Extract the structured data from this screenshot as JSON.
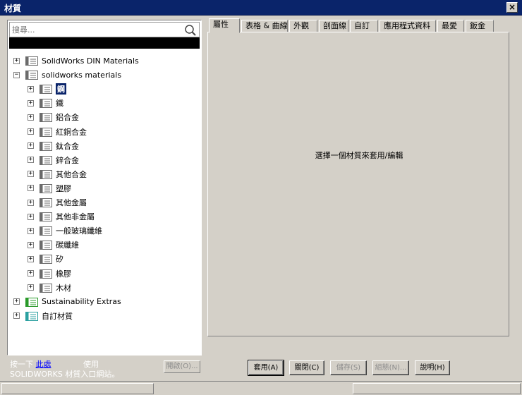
{
  "window": {
    "title": "材質"
  },
  "search": {
    "placeholder": "搜尋..."
  },
  "tree": [
    {
      "label": "SolidWorks DIN Materials",
      "level": 0,
      "expander": "+",
      "icon_color": "#6b6b6b"
    },
    {
      "label": "solidworks materials",
      "level": 0,
      "expander": "−",
      "icon_color": "#6b6b6b"
    },
    {
      "label": "鋼",
      "level": 1,
      "expander": "+",
      "icon_color": "#6b6b6b",
      "selected": true
    },
    {
      "label": "鐵",
      "level": 1,
      "expander": "+",
      "icon_color": "#6b6b6b"
    },
    {
      "label": "鋁合金",
      "level": 1,
      "expander": "+",
      "icon_color": "#6b6b6b"
    },
    {
      "label": "紅銅合金",
      "level": 1,
      "expander": "+",
      "icon_color": "#6b6b6b"
    },
    {
      "label": "鈦合金",
      "level": 1,
      "expander": "+",
      "icon_color": "#6b6b6b"
    },
    {
      "label": "鋅合金",
      "level": 1,
      "expander": "+",
      "icon_color": "#6b6b6b"
    },
    {
      "label": "其他合金",
      "level": 1,
      "expander": "+",
      "icon_color": "#6b6b6b"
    },
    {
      "label": "塑膠",
      "level": 1,
      "expander": "+",
      "icon_color": "#6b6b6b"
    },
    {
      "label": "其他金屬",
      "level": 1,
      "expander": "+",
      "icon_color": "#6b6b6b"
    },
    {
      "label": "其他非金屬",
      "level": 1,
      "expander": "+",
      "icon_color": "#6b6b6b"
    },
    {
      "label": "一般玻璃纖維",
      "level": 1,
      "expander": "+",
      "icon_color": "#6b6b6b"
    },
    {
      "label": "碳纖維",
      "level": 1,
      "expander": "+",
      "icon_color": "#6b6b6b"
    },
    {
      "label": "矽",
      "level": 1,
      "expander": "+",
      "icon_color": "#6b6b6b"
    },
    {
      "label": "橡膠",
      "level": 1,
      "expander": "+",
      "icon_color": "#6b6b6b"
    },
    {
      "label": "木材",
      "level": 1,
      "expander": "+",
      "icon_color": "#6b6b6b"
    },
    {
      "label": "Sustainability Extras",
      "level": 0,
      "expander": "+",
      "icon_color": "#2a9a2a"
    },
    {
      "label": "自訂材質",
      "level": 0,
      "expander": "+",
      "icon_color": "#2aa0a0"
    }
  ],
  "left_bottom": {
    "line1_prefix": "按一下",
    "line1_link": "此處",
    "line1_suffix": "使用",
    "line2": "SOLIDWORKS 材質入口網站。",
    "open_button": "開啟(O)..."
  },
  "tabs": [
    "屬性",
    "表格 & 曲線",
    "外觀",
    "剖面線",
    "自訂",
    "應用程式資料",
    "最愛",
    "鈑金"
  ],
  "active_tab": 0,
  "panel": {
    "hint": "選擇一個材質來套用/編輯"
  },
  "buttons": {
    "apply": "套用(A)",
    "close": "關閉(C)",
    "save": "儲存(S)",
    "config": "組態(N)...",
    "help": "說明(H)"
  },
  "colors": {
    "title_bar": "#0a246a",
    "dialog_bg": "#d4d0c8",
    "selection": "#0a246a"
  }
}
